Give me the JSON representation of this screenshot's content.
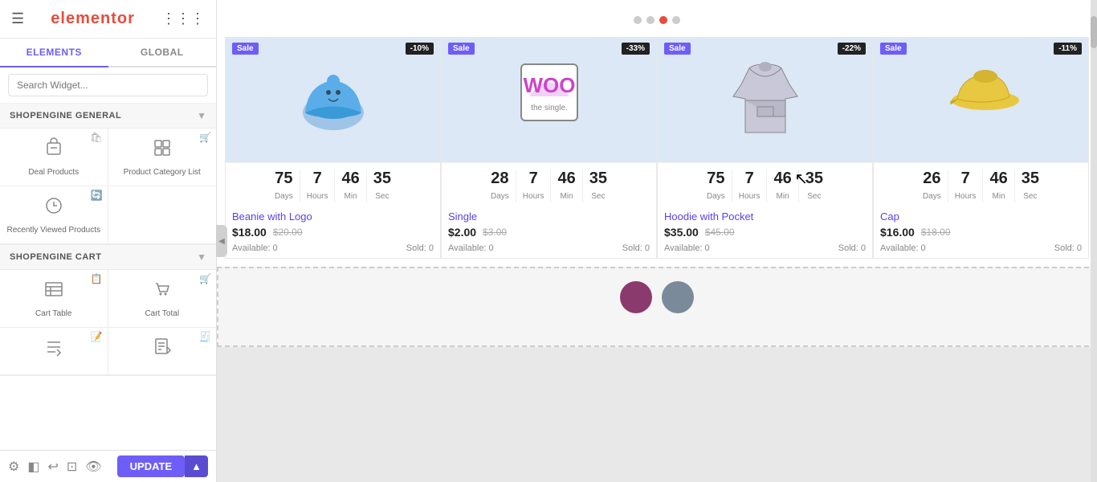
{
  "sidebar": {
    "logo": "elementor",
    "hamburger_label": "☰",
    "grid_label": "⋮⋮⋮",
    "tabs": [
      {
        "label": "ELEMENTS",
        "active": true
      },
      {
        "label": "GLOBAL",
        "active": false
      }
    ],
    "search_placeholder": "Search Widget...",
    "sections": [
      {
        "title": "SHOPENGINE GENERAL",
        "widgets": [
          {
            "label": "Deal Products",
            "icon": "🛍"
          },
          {
            "label": "Product Category List",
            "icon": "🛒"
          },
          {
            "label": "Recently Viewed Products",
            "icon": "🔄"
          },
          {
            "label": "",
            "icon": ""
          }
        ]
      },
      {
        "title": "SHOPENGINE CART",
        "widgets": [
          {
            "label": "Cart Table",
            "icon": "📋"
          },
          {
            "label": "Cart Total",
            "icon": "🛒"
          },
          {
            "label": "",
            "icon": ""
          },
          {
            "label": "",
            "icon": ""
          }
        ]
      }
    ],
    "footer": {
      "update_label": "UPDATE"
    }
  },
  "canvas": {
    "dots": [
      {
        "active": false
      },
      {
        "active": false
      },
      {
        "active": true
      },
      {
        "active": false
      }
    ],
    "products": [
      {
        "badge_sale": "Sale",
        "badge_discount": "-10%",
        "countdown": {
          "days": 75,
          "hours": 7,
          "min": 46,
          "sec": 35
        },
        "name": "Beanie with Logo",
        "price_current": "$18.00",
        "price_old": "$20.00",
        "available": "Available: 0",
        "sold": "Sold: 0"
      },
      {
        "badge_sale": "Sale",
        "badge_discount": "-33%",
        "countdown": {
          "days": 28,
          "hours": 7,
          "min": 46,
          "sec": 35
        },
        "name": "Single",
        "price_current": "$2.00",
        "price_old": "$3.00",
        "available": "Available: 0",
        "sold": "Sold: 0"
      },
      {
        "badge_sale": "Sale",
        "badge_discount": "-22%",
        "countdown": {
          "days": 75,
          "hours": 7,
          "min": 46,
          "sec": 35
        },
        "name": "Hoodie with Pocket",
        "price_current": "$35.00",
        "price_old": "$45.00",
        "available": "Available: 0",
        "sold": "Sold: 0"
      },
      {
        "badge_sale": "Sale",
        "badge_discount": "-11%",
        "countdown": {
          "days": 26,
          "hours": 7,
          "min": 46,
          "sec": 35
        },
        "name": "Cap",
        "price_current": "$16.00",
        "price_old": "$18.00",
        "available": "Available: 0",
        "sold": "Sold: 0"
      }
    ],
    "cursor_visible": true
  },
  "labels": {
    "days": "Days",
    "hours": "Hours",
    "min": "Min",
    "sec": "Sec"
  }
}
